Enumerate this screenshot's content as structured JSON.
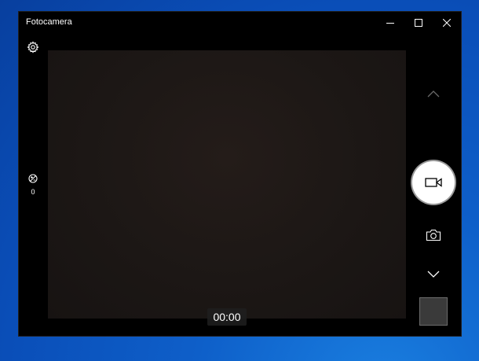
{
  "window": {
    "title": "Fotocamera"
  },
  "controls": {
    "exposure_value": "0",
    "timer": "00:00",
    "mode": "video"
  },
  "colors": {
    "desktop": "#0a4eb8",
    "window_bg": "#000000",
    "record_button": "#ffffff"
  },
  "icons": {
    "settings": "gear-icon",
    "exposure": "exposure-icon",
    "mode_up": "chevron-up-icon",
    "record": "video-camera-icon",
    "photo": "camera-icon",
    "mode_down": "chevron-down-icon"
  }
}
